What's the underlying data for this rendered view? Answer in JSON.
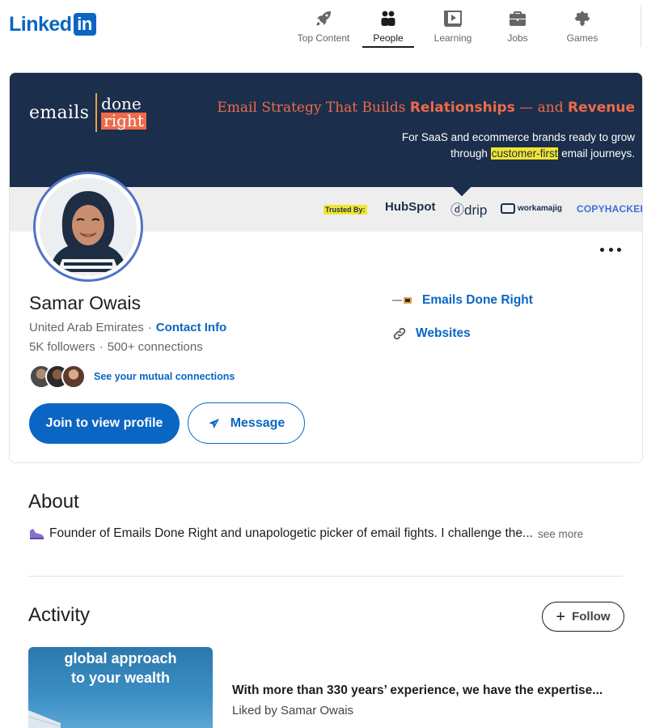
{
  "header": {
    "logo_text": "Linked",
    "logo_box": "in",
    "nav": [
      {
        "label": "Top Content",
        "icon": "rocket-icon"
      },
      {
        "label": "People",
        "icon": "people-icon",
        "active": true
      },
      {
        "label": "Learning",
        "icon": "video-icon"
      },
      {
        "label": "Jobs",
        "icon": "briefcase-icon"
      },
      {
        "label": "Games",
        "icon": "puzzle-icon"
      }
    ]
  },
  "banner": {
    "logo_emails": "emails",
    "logo_done": "done",
    "logo_right": "right",
    "headline_pre": "Email Strategy That Builds ",
    "headline_bold1": "Relationships",
    "headline_mid": " — and ",
    "headline_bold2": "Revenue",
    "sub1": "For SaaS and ecommerce brands ready to grow",
    "sub2_pre": "through ",
    "sub2_mark": "customer-first",
    "sub2_post": " email journeys.",
    "trusted": "Trusted By:",
    "brands": [
      "HubSpot",
      "drip",
      "workamajig",
      "COPYHACKERS"
    ],
    "colors": {
      "navy": "#1b2e4b",
      "coral": "#ee6a4a",
      "highlight": "#f2e532"
    }
  },
  "profile": {
    "name": "Samar Owais",
    "location": "United Arab Emirates",
    "contact": "Contact Info",
    "followers": "5K followers",
    "connections": "500+ connections",
    "mutual": "See your mutual connections",
    "company": "Emails Done Right",
    "websites": "Websites",
    "join_button": "Join to view profile",
    "message_button": "Message"
  },
  "about": {
    "title": "About",
    "text": "Founder of Emails Done Right and unapologetic picker of email fights. I challenge the...",
    "see_more": "see more"
  },
  "activity": {
    "title": "Activity",
    "follow": "Follow",
    "thumb_line1": "global approach",
    "thumb_line2": "to your wealth",
    "post_title": "With more than 330 years’ experience, we have the expertise...",
    "post_sub": "Liked by Samar Owais"
  },
  "accent": "#0a66c2"
}
